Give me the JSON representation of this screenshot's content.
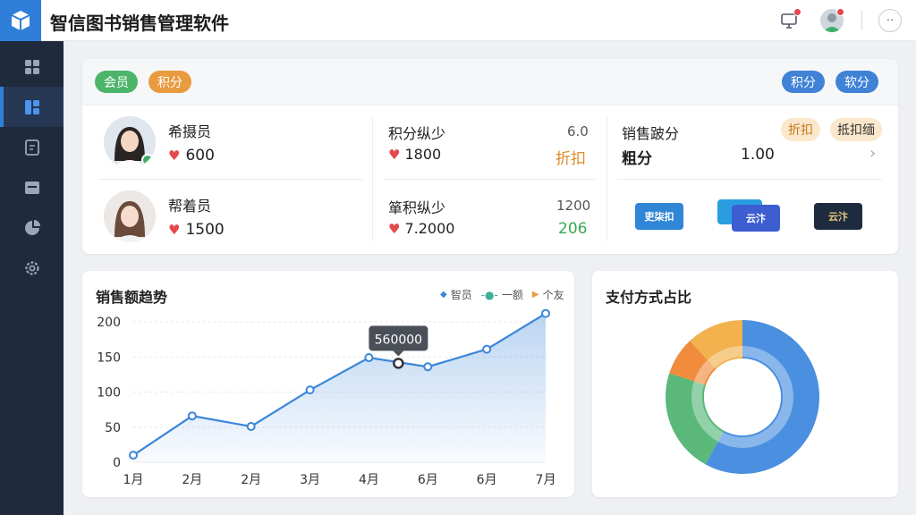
{
  "app": {
    "title": "智信图书销售管理软件"
  },
  "sidebar": {
    "items": [
      {
        "icon": "dashboard-icon"
      },
      {
        "icon": "reports-icon"
      },
      {
        "icon": "document-icon"
      },
      {
        "icon": "archive-icon"
      },
      {
        "icon": "pie-icon"
      },
      {
        "icon": "settings-icon"
      }
    ]
  },
  "top_tags": {
    "left": [
      "会员",
      "积分"
    ],
    "right": [
      "积分",
      "软分"
    ],
    "colors": {
      "green": "#4cb56a",
      "orange": "#e89b3f",
      "blue": "#3f82d6"
    }
  },
  "members": [
    {
      "name": "希摄员",
      "value": "600"
    },
    {
      "name": "帮着员",
      "value": "1500"
    }
  ],
  "stats_mid": [
    {
      "label": "积分纵少",
      "top_num": "6.0",
      "value": "1800",
      "tag": "折扣"
    },
    {
      "label": "箪积纵少",
      "top_num": "1200",
      "value": "7.2000",
      "tag": "206"
    }
  ],
  "stats_right": {
    "title": "销售跛分",
    "tags": [
      "折扣",
      "抵扣缅"
    ],
    "label": "粗分",
    "value": "1.00",
    "chevron": "›",
    "pay_cards": [
      "吏柒扣",
      "云汴",
      "云汴"
    ]
  },
  "line_chart_title": "销售额趋势",
  "line_legend": [
    "智员",
    "一额",
    "个友"
  ],
  "tooltip": "560000",
  "pie_title": "支付方式占比",
  "chart_data": [
    {
      "type": "line",
      "title": "销售额趋势",
      "x": [
        "1月",
        "2月",
        "2月",
        "3月",
        "4月",
        "6月",
        "6月",
        "7月"
      ],
      "series": [
        {
          "name": "智员",
          "values": [
            10,
            66,
            51,
            103,
            149,
            136,
            161,
            212
          ]
        }
      ],
      "extra_point": {
        "x_between": [
          "4月",
          "6月"
        ],
        "y": 141
      },
      "ylim": [
        0,
        200
      ],
      "yticks": [
        0,
        50,
        100,
        150,
        200
      ],
      "grid": true,
      "legend": "top-right",
      "color": "#3b86d9"
    },
    {
      "type": "pie",
      "title": "支付方式占比",
      "donut": true,
      "slices": [
        {
          "value": 58,
          "color": "#4a8fe0"
        },
        {
          "value": 22,
          "color": "#59b87a"
        },
        {
          "value": 8,
          "color": "#f08c3c"
        },
        {
          "value": 12,
          "color": "#f3b24e"
        }
      ]
    }
  ]
}
